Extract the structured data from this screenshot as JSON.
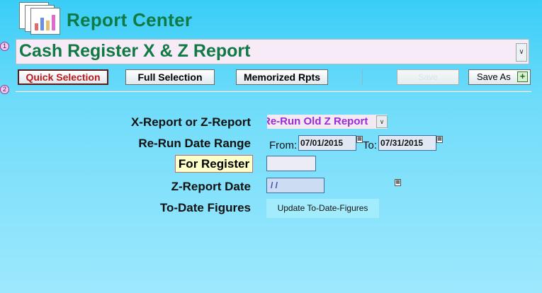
{
  "header": {
    "app_title": "Report Center"
  },
  "badges": {
    "step1": "1",
    "step2": "2"
  },
  "report": {
    "title": "Cash Register X & Z Report",
    "dropdown_icon": "chevron-down-icon"
  },
  "toolbar": {
    "quick_selection": "Quick Selection",
    "full_selection": "Full Selection",
    "memorized_rpts": "Memorized Rpts",
    "save": "Save",
    "save_as": "Save As"
  },
  "form": {
    "xz_label": "X-Report or Z-Report",
    "xz_value": "Re-Run Old Z Report",
    "rerun_label": "Re-Run Date Range",
    "from_label": "From:",
    "from_value": "07/01/2015",
    "to_label": "To:",
    "to_value": "07/31/2015",
    "register_label": "For Register",
    "register_value": "",
    "zdate_label": "Z-Report Date",
    "zdate_value": "/ /",
    "todate_label": "To-Date Figures",
    "update_button": "Update To-Date-Figures"
  },
  "colors": {
    "title_green": "#107a44",
    "quick_red": "#c0171a",
    "select_purple": "#9b2bd3",
    "background": "#6fdcfa"
  }
}
